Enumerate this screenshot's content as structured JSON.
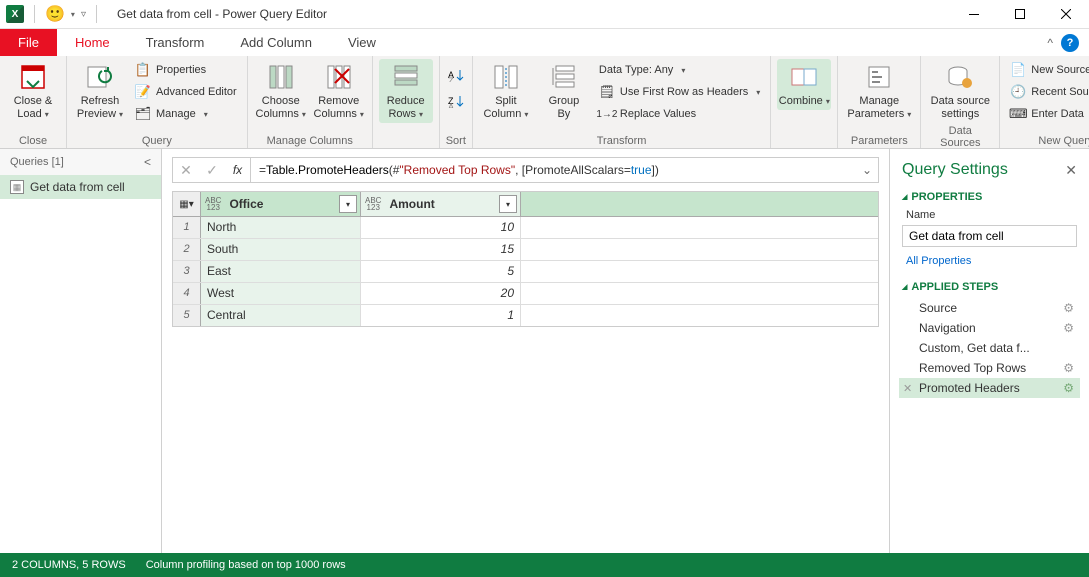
{
  "title": "Get data from cell - Power Query Editor",
  "tabs": {
    "file": "File",
    "home": "Home",
    "transform": "Transform",
    "addcol": "Add Column",
    "view": "View"
  },
  "ribbon": {
    "close": {
      "big": "Close &\nLoad",
      "label": "Close"
    },
    "query": {
      "refresh": "Refresh\nPreview",
      "props": "Properties",
      "adv": "Advanced Editor",
      "manage": "Manage",
      "label": "Query"
    },
    "managecols": {
      "choose": "Choose\nColumns",
      "remove": "Remove\nColumns",
      "label": "Manage Columns"
    },
    "reducerows": {
      "reduce": "Reduce\nRows",
      "label": ""
    },
    "sort": {
      "label": "Sort"
    },
    "split": {
      "split": "Split\nColumn"
    },
    "group": {
      "group": "Group\nBy"
    },
    "transform": {
      "datatype": "Data Type: Any",
      "firstrow": "Use First Row as Headers",
      "replace": "Replace Values",
      "label": "Transform"
    },
    "combine": {
      "combine": "Combine",
      "label": ""
    },
    "params": {
      "manage": "Manage\nParameters",
      "label": "Parameters"
    },
    "ds": {
      "ds": "Data source\nsettings",
      "label": "Data Sources"
    },
    "newq": {
      "new": "New Source",
      "recent": "Recent Sources",
      "enter": "Enter Data",
      "label": "New Query"
    }
  },
  "queries": {
    "header": "Queries [1]",
    "item": "Get data from cell"
  },
  "formula": {
    "prefix": "= ",
    "func": "Table.PromoteHeaders",
    "open": "(#",
    "str": "\"Removed Top Rows\"",
    "mid": ", [PromoteAllScalars=",
    "true": "true",
    "end": "])"
  },
  "table": {
    "cols": [
      "Office",
      "Amount"
    ],
    "rows": [
      {
        "n": "1",
        "office": "North",
        "amount": "10"
      },
      {
        "n": "2",
        "office": "South",
        "amount": "15"
      },
      {
        "n": "3",
        "office": "East",
        "amount": "5"
      },
      {
        "n": "4",
        "office": "West",
        "amount": "20"
      },
      {
        "n": "5",
        "office": "Central",
        "amount": "1"
      }
    ]
  },
  "settings": {
    "title": "Query Settings",
    "props": "PROPERTIES",
    "name_label": "Name",
    "name_value": "Get data from cell",
    "allprops": "All Properties",
    "steps": "APPLIED STEPS",
    "steplist": [
      "Source",
      "Navigation",
      "Custom, Get data f...",
      "Removed Top Rows",
      "Promoted Headers"
    ]
  },
  "status": {
    "cols": "2 COLUMNS, 5 ROWS",
    "profile": "Column profiling based on top 1000 rows"
  }
}
